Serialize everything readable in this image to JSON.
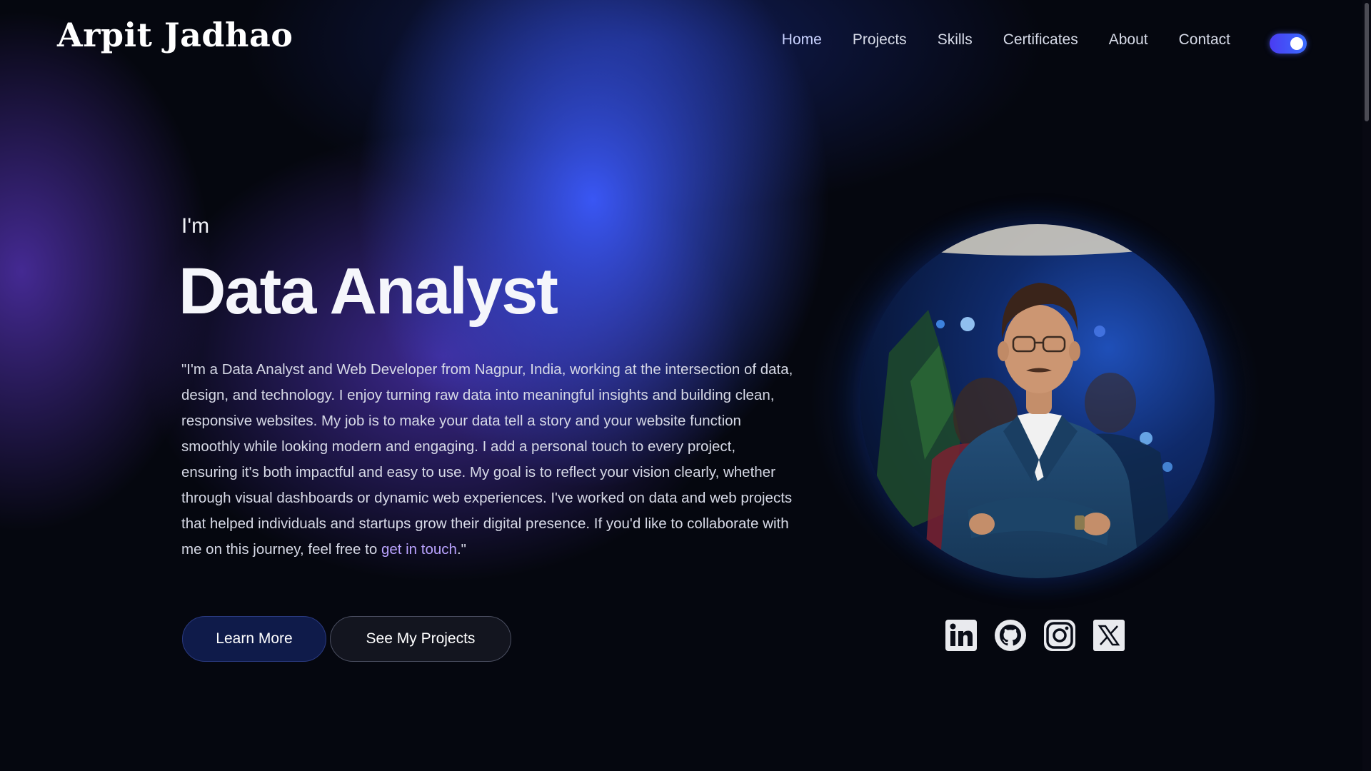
{
  "header": {
    "logo": "Arpit Jadhao",
    "nav": [
      "Home",
      "Projects",
      "Skills",
      "Certificates",
      "About",
      "Contact"
    ],
    "theme_toggle": {
      "state": "on",
      "color": "#4a56f5"
    }
  },
  "hero": {
    "intro": "I'm",
    "role": "Data Analyst",
    "bio_text": "\"I'm a Data Analyst and Web Developer from Nagpur, India, working at the intersection of data, design, and technology. I enjoy turning raw data into meaningful insights and building clean, responsive websites. My job is to make your data tell a story and your website function smoothly while looking modern and engaging. I add a personal touch to every project, ensuring it's both impactful and easy to use. My goal is to reflect your vision clearly, whether through visual dashboards or dynamic web experiences. I've worked on data and web projects that helped individuals and startups grow their digital presence. If you'd like to collaborate with me on this journey, feel free to ",
    "bio_link": "get in touch",
    "bio_end": ".\"",
    "buttons": {
      "learn_more": "Learn More",
      "see_projects": "See My Projects"
    }
  },
  "socials": [
    "linkedin-icon",
    "github-icon",
    "instagram-icon",
    "x-icon"
  ],
  "colors": {
    "background": "#05070f",
    "accent_blue": "#3b5bff",
    "accent_purple": "#7b4dff",
    "link": "#b9a3ff"
  }
}
